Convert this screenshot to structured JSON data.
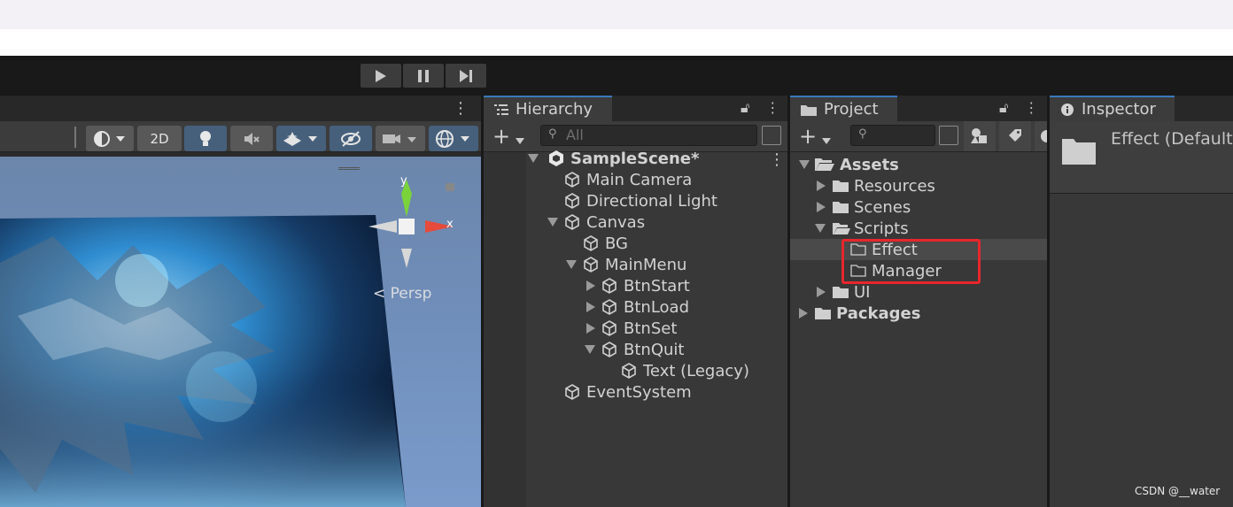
{
  "toolbar": {
    "play_icon": "play-icon",
    "pause_icon": "pause-icon",
    "step_icon": "step-icon"
  },
  "scene": {
    "btn_2d": "2D",
    "gizmo_y": "y",
    "gizmo_x": "x",
    "persp_label": "< Persp"
  },
  "hierarchy": {
    "tab_label": "Hierarchy",
    "search_placeholder": "All",
    "items": [
      {
        "label": "SampleScene*"
      },
      {
        "label": "Main Camera"
      },
      {
        "label": "Directional Light"
      },
      {
        "label": "Canvas"
      },
      {
        "label": "BG"
      },
      {
        "label": "MainMenu"
      },
      {
        "label": "BtnStart"
      },
      {
        "label": "BtnLoad"
      },
      {
        "label": "BtnSet"
      },
      {
        "label": "BtnQuit"
      },
      {
        "label": "Text (Legacy)"
      },
      {
        "label": "EventSystem"
      }
    ]
  },
  "project": {
    "tab_label": "Project",
    "items": [
      {
        "label": "Assets"
      },
      {
        "label": "Resources"
      },
      {
        "label": "Scenes"
      },
      {
        "label": "Scripts"
      },
      {
        "label": "Effect"
      },
      {
        "label": "Manager"
      },
      {
        "label": "UI"
      },
      {
        "label": "Packages"
      }
    ],
    "highlight_color": "#e8262c"
  },
  "inspector": {
    "tab_label": "Inspector",
    "title": "Effect (Default"
  },
  "watermark": "CSDN @__water"
}
